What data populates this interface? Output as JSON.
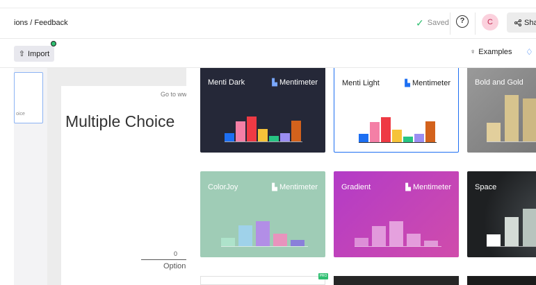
{
  "header": {
    "breadcrumb": "ions / Feedback",
    "saved_label": "Saved",
    "help_glyph": "?",
    "avatar_initial": "C",
    "share_label": "Shar"
  },
  "toolbar": {
    "import_label": "Import",
    "examples_label": "Examples"
  },
  "sidebar": {
    "slide_label": "oice"
  },
  "slide": {
    "goto_text": "Go to ww",
    "title": "Multiple Choice",
    "axis_value": "0",
    "option_label": "Option"
  },
  "themes": [
    {
      "name": "Menti Dark",
      "brand": "Mentimeter",
      "bg": "#252838",
      "text": "#ffffff",
      "bars": [
        {
          "color": "#1d6ff2",
          "value": 0.25
        },
        {
          "color": "#f47fa6",
          "value": 0.6
        },
        {
          "color": "#ee3a44",
          "value": 0.75
        },
        {
          "color": "#f6c339",
          "value": 0.37
        },
        {
          "color": "#27c483",
          "value": 0.17
        },
        {
          "color": "#9b8ef2",
          "value": 0.25
        },
        {
          "color": "#d3621c",
          "value": 0.62
        }
      ]
    },
    {
      "name": "Menti Light",
      "brand": "Mentimeter",
      "bg": "#ffffff",
      "text": "#222222",
      "selected": true,
      "bars": [
        {
          "color": "#1d6ff2",
          "value": 0.25
        },
        {
          "color": "#f47fa6",
          "value": 0.6
        },
        {
          "color": "#ee3a44",
          "value": 0.75
        },
        {
          "color": "#f6c339",
          "value": 0.37
        },
        {
          "color": "#27c483",
          "value": 0.17
        },
        {
          "color": "#9b8ef2",
          "value": 0.25
        },
        {
          "color": "#d3621c",
          "value": 0.62
        }
      ]
    },
    {
      "name": "Bold and Gold",
      "brand": "",
      "bg": "#838383",
      "text": "#ffffff",
      "bars": [
        {
          "color": "#e2cf9c",
          "value": 0.4
        },
        {
          "color": "#d7c48e",
          "value": 1.0
        },
        {
          "color": "#cdb883",
          "value": 0.92
        }
      ]
    },
    {
      "name": "ColorJoy",
      "brand": "Mentimeter",
      "bg": "#9fccb6",
      "text": "#ffffff",
      "bars": [
        {
          "color": "#aee3cb",
          "value": 0.25
        },
        {
          "color": "#9fd2ea",
          "value": 0.62
        },
        {
          "color": "#b28ee6",
          "value": 0.75
        },
        {
          "color": "#e893bd",
          "value": 0.37
        },
        {
          "color": "#8a7fda",
          "value": 0.18
        }
      ]
    },
    {
      "name": "Gradient",
      "brand": "Mentimeter",
      "bg": "#bc3fc0",
      "text": "#ffffff",
      "bars": [
        {
          "color": "#dd8fd8",
          "value": 0.25
        },
        {
          "color": "#e299dc",
          "value": 0.6
        },
        {
          "color": "#e5a1de",
          "value": 0.75
        },
        {
          "color": "#e49cdc",
          "value": 0.37
        },
        {
          "color": "#e19bd9",
          "value": 0.17
        }
      ]
    },
    {
      "name": "Space",
      "brand": "",
      "bg": "#2b2e30",
      "text": "#ffffff",
      "bars": [
        {
          "color": "#ffffff",
          "value": 0.25
        },
        {
          "color": "#d4dbd6",
          "value": 0.62
        },
        {
          "color": "#b8c4be",
          "value": 0.8
        }
      ]
    }
  ],
  "pro_badge": "PRO",
  "colors": {
    "accent": "#1d6ff2",
    "saved_check": "#2fbf71",
    "avatar_bg": "#fbd1dd"
  }
}
